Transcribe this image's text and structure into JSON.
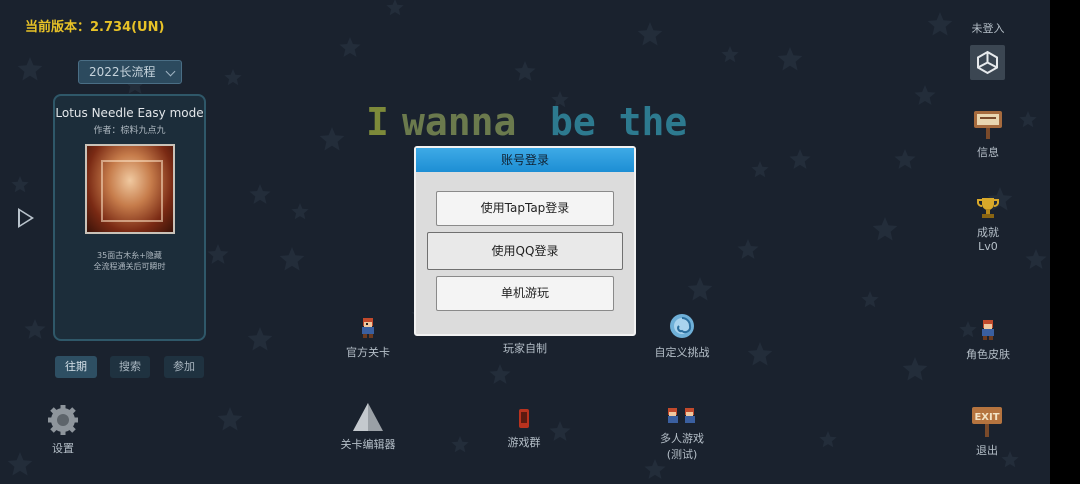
{
  "header": {
    "version": "当前版本：2.734(UN)"
  },
  "account": {
    "status": "未登入"
  },
  "left_panel": {
    "year_select": "2022长流程",
    "card": {
      "title": "Lotus Needle Easy mode",
      "author": "作者：棕料九点九",
      "desc_line1": "35面古木糸+隐藏",
      "desc_line2": "全流程通关后可瞬时"
    },
    "tabs": [
      "往期",
      "搜索",
      "参加"
    ]
  },
  "title_words": [
    {
      "text": "I",
      "color": "#7d8a3a"
    },
    {
      "text": "wanna",
      "color": "#6b7a4d"
    },
    {
      "text": "be the",
      "color": "#2d7a8f"
    }
  ],
  "login_dialog": {
    "title": "账号登录",
    "taptap_button": "使用TapTap登录",
    "qq_button": "使用QQ登录",
    "offline_button": "单机游玩"
  },
  "menu": {
    "official_levels": "官方关卡",
    "player_made": "玩家自制",
    "custom_challenge": "自定义挑战",
    "level_editor": "关卡编辑器",
    "game_group": "游戏群",
    "multiplayer_line1": "多人游戏",
    "multiplayer_line2": "(测试)",
    "settings": "设置"
  },
  "right_panel": {
    "mail": "信息",
    "achievement": "成就",
    "achievement_level": "Lv0",
    "skin": "角色皮肤",
    "exit": "退出",
    "exit_sign": "EXIT"
  },
  "colors": {
    "version": "#e8c227",
    "dialog_header": "#2a9fe0",
    "background": "#1a222e"
  },
  "icons": [
    "unity-icon",
    "sign-icon",
    "trophy-icon",
    "kid-icon",
    "play-arrow-icon",
    "gear-icon",
    "triangle-icon",
    "phone-icon",
    "spiral-icon",
    "exit-sign-icon"
  ]
}
